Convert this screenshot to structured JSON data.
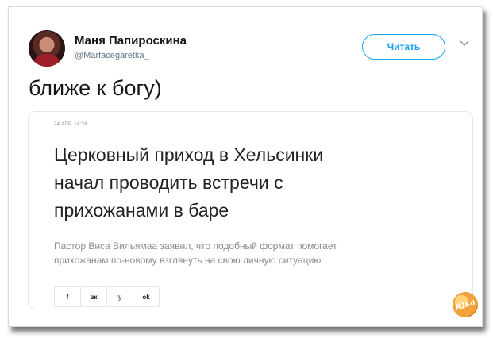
{
  "tweet": {
    "author": {
      "display_name": "Маня Папироскина",
      "handle": "@Marfacegaretka_"
    },
    "follow_label": "Читать",
    "text": "ближе к богу)",
    "accent_color": "#1da1f2"
  },
  "card": {
    "date": "24 АПР, 14:38",
    "title": "Церковный приход в Хельсинки\nначал проводить встречи с\nприхожанами в баре",
    "lead": "Пастор Виса Вильямаа заявил, что подобный формат помогает\nприхожанам по-новому взглянуть на свою личную ситуацию",
    "share_buttons": [
      {
        "label": "f",
        "icon": "facebook-icon"
      },
      {
        "label": "вк",
        "icon": "vk-icon"
      },
      {
        "label": "𝕪",
        "icon": "twitter-icon"
      },
      {
        "label": "ok",
        "icon": "odnoklassniki-icon"
      }
    ]
  },
  "watermark": {
    "text": "Юка"
  }
}
